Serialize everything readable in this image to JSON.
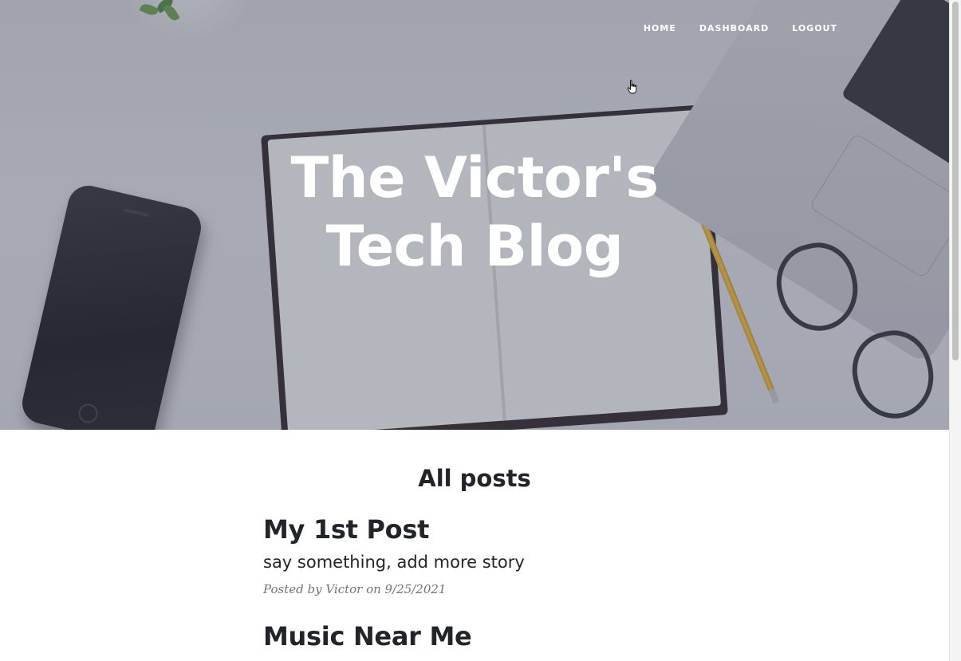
{
  "nav": {
    "items": [
      {
        "label": "HOME"
      },
      {
        "label": "DASHBOARD"
      },
      {
        "label": "LOGOUT"
      }
    ]
  },
  "hero": {
    "title_line1": "The Victor's",
    "title_line2": "Tech Blog"
  },
  "main": {
    "section_title": "All posts",
    "posts": [
      {
        "title": "My 1st Post",
        "subtitle": "say something, add more story",
        "meta": "Posted by Victor on 9/25/2021"
      },
      {
        "title": "Music Near Me",
        "subtitle": "",
        "meta": ""
      }
    ]
  },
  "colors": {
    "text": "#212529",
    "meta": "#6c757d",
    "nav_text": "#ffffff",
    "hero_overlay": "rgba(70,76,100,0.38)"
  },
  "icons": {
    "cursor": "hand-pointer-icon"
  }
}
